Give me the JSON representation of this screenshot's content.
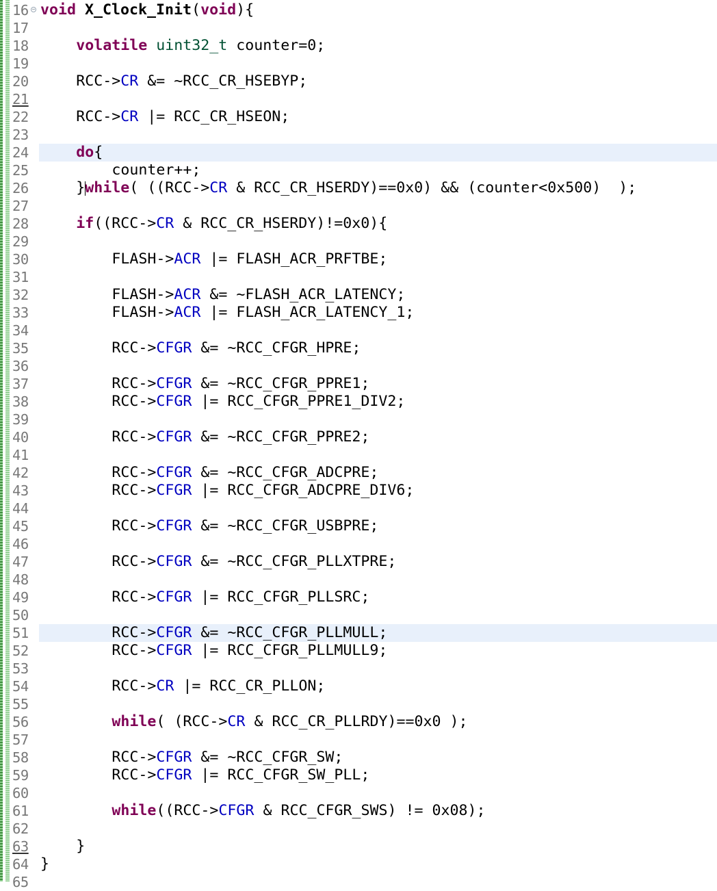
{
  "editor": {
    "language": "c",
    "colors": {
      "keyword": "#7f0055",
      "field": "#0000c0",
      "type": "#005032",
      "line_number": "#787878",
      "current_line_highlight": "#e8f0fb",
      "change_marker": "#3f8f3f"
    },
    "lines": [
      {
        "n": "16",
        "fold": true,
        "indent": 0,
        "tokens": [
          {
            "t": "void",
            "c": "kw"
          },
          {
            "t": " "
          },
          {
            "t": "X_Clock_Init",
            "c": "bold"
          },
          {
            "t": "("
          },
          {
            "t": "void",
            "c": "kw"
          },
          {
            "t": "){"
          }
        ]
      },
      {
        "n": "17",
        "indent": 0,
        "tokens": []
      },
      {
        "n": "18",
        "indent": 1,
        "tokens": [
          {
            "t": "volatile",
            "c": "kw"
          },
          {
            "t": " "
          },
          {
            "t": "uint32_t",
            "c": "type"
          },
          {
            "t": " counter=0;"
          }
        ]
      },
      {
        "n": "19",
        "indent": 0,
        "tokens": []
      },
      {
        "n": "20",
        "indent": 1,
        "tokens": [
          {
            "t": "RCC->"
          },
          {
            "t": "CR",
            "c": "field"
          },
          {
            "t": " &= ~RCC_CR_HSEBYP;"
          }
        ]
      },
      {
        "n": "21",
        "underline": true,
        "indent": 0,
        "tokens": []
      },
      {
        "n": "22",
        "indent": 1,
        "tokens": [
          {
            "t": "RCC->"
          },
          {
            "t": "CR",
            "c": "field"
          },
          {
            "t": " |= RCC_CR_HSEON;"
          }
        ]
      },
      {
        "n": "23",
        "indent": 0,
        "tokens": []
      },
      {
        "n": "24",
        "highlight": true,
        "indent": 1,
        "tokens": [
          {
            "t": "do",
            "c": "kw"
          },
          {
            "t": "{"
          }
        ]
      },
      {
        "n": "25",
        "indent": 2,
        "tokens": [
          {
            "t": "counter++;"
          }
        ]
      },
      {
        "n": "26",
        "indent": 1,
        "cursor": true,
        "tokens": [
          {
            "t": "}"
          },
          {
            "t": "while",
            "c": "kw"
          },
          {
            "t": "( ((RCC->"
          },
          {
            "t": "CR",
            "c": "field"
          },
          {
            "t": " & RCC_CR_HSERDY)==0x0) && (counter<0x500)  );"
          }
        ]
      },
      {
        "n": "27",
        "indent": 0,
        "tokens": []
      },
      {
        "n": "28",
        "indent": 1,
        "tokens": [
          {
            "t": "if",
            "c": "kw"
          },
          {
            "t": "((RCC->"
          },
          {
            "t": "CR",
            "c": "field"
          },
          {
            "t": " & RCC_CR_HSERDY)!=0x0){"
          }
        ]
      },
      {
        "n": "29",
        "indent": 0,
        "tokens": []
      },
      {
        "n": "30",
        "indent": 2,
        "tokens": [
          {
            "t": "FLASH->"
          },
          {
            "t": "ACR",
            "c": "field"
          },
          {
            "t": " |= FLASH_ACR_PRFTBE;"
          }
        ]
      },
      {
        "n": "31",
        "indent": 0,
        "tokens": []
      },
      {
        "n": "32",
        "indent": 2,
        "tokens": [
          {
            "t": "FLASH->"
          },
          {
            "t": "ACR",
            "c": "field"
          },
          {
            "t": " &= ~FLASH_ACR_LATENCY;"
          }
        ]
      },
      {
        "n": "33",
        "indent": 2,
        "tokens": [
          {
            "t": "FLASH->"
          },
          {
            "t": "ACR",
            "c": "field"
          },
          {
            "t": " |= FLASH_ACR_LATENCY_1;"
          }
        ]
      },
      {
        "n": "34",
        "indent": 0,
        "tokens": []
      },
      {
        "n": "35",
        "indent": 2,
        "tokens": [
          {
            "t": "RCC->"
          },
          {
            "t": "CFGR",
            "c": "field"
          },
          {
            "t": " &= ~RCC_CFGR_HPRE;"
          }
        ]
      },
      {
        "n": "36",
        "indent": 0,
        "tokens": []
      },
      {
        "n": "37",
        "indent": 2,
        "tokens": [
          {
            "t": "RCC->"
          },
          {
            "t": "CFGR",
            "c": "field"
          },
          {
            "t": " &= ~RCC_CFGR_PPRE1;"
          }
        ]
      },
      {
        "n": "38",
        "indent": 2,
        "tokens": [
          {
            "t": "RCC->"
          },
          {
            "t": "CFGR",
            "c": "field"
          },
          {
            "t": " |= RCC_CFGR_PPRE1_DIV2;"
          }
        ]
      },
      {
        "n": "39",
        "indent": 0,
        "tokens": []
      },
      {
        "n": "40",
        "indent": 2,
        "tokens": [
          {
            "t": "RCC->"
          },
          {
            "t": "CFGR",
            "c": "field"
          },
          {
            "t": " &= ~RCC_CFGR_PPRE2;"
          }
        ]
      },
      {
        "n": "41",
        "indent": 0,
        "tokens": []
      },
      {
        "n": "42",
        "indent": 2,
        "tokens": [
          {
            "t": "RCC->"
          },
          {
            "t": "CFGR",
            "c": "field"
          },
          {
            "t": " &= ~RCC_CFGR_ADCPRE;"
          }
        ]
      },
      {
        "n": "43",
        "indent": 2,
        "tokens": [
          {
            "t": "RCC->"
          },
          {
            "t": "CFGR",
            "c": "field"
          },
          {
            "t": " |= RCC_CFGR_ADCPRE_DIV6;"
          }
        ]
      },
      {
        "n": "44",
        "indent": 0,
        "tokens": []
      },
      {
        "n": "45",
        "indent": 2,
        "tokens": [
          {
            "t": "RCC->"
          },
          {
            "t": "CFGR",
            "c": "field"
          },
          {
            "t": " &= ~RCC_CFGR_USBPRE;"
          }
        ]
      },
      {
        "n": "46",
        "indent": 0,
        "tokens": []
      },
      {
        "n": "47",
        "indent": 2,
        "tokens": [
          {
            "t": "RCC->"
          },
          {
            "t": "CFGR",
            "c": "field"
          },
          {
            "t": " &= ~RCC_CFGR_PLLXTPRE;"
          }
        ]
      },
      {
        "n": "48",
        "indent": 0,
        "tokens": []
      },
      {
        "n": "49",
        "indent": 2,
        "tokens": [
          {
            "t": "RCC->"
          },
          {
            "t": "CFGR",
            "c": "field"
          },
          {
            "t": " |= RCC_CFGR_PLLSRC;"
          }
        ]
      },
      {
        "n": "50",
        "indent": 0,
        "tokens": []
      },
      {
        "n": "51",
        "highlight": true,
        "indent": 2,
        "tokens": [
          {
            "t": "RCC->"
          },
          {
            "t": "CFGR",
            "c": "field"
          },
          {
            "t": " &= ~RCC_CFGR_PLLMULL;"
          }
        ]
      },
      {
        "n": "52",
        "indent": 2,
        "tokens": [
          {
            "t": "RCC->"
          },
          {
            "t": "CFGR",
            "c": "field"
          },
          {
            "t": " |= RCC_CFGR_PLLMULL9;"
          }
        ]
      },
      {
        "n": "53",
        "indent": 0,
        "tokens": []
      },
      {
        "n": "54",
        "indent": 2,
        "tokens": [
          {
            "t": "RCC->"
          },
          {
            "t": "CR",
            "c": "field"
          },
          {
            "t": " |= RCC_CR_PLLON;"
          }
        ]
      },
      {
        "n": "55",
        "indent": 0,
        "tokens": []
      },
      {
        "n": "56",
        "indent": 2,
        "tokens": [
          {
            "t": "while",
            "c": "kw"
          },
          {
            "t": "( (RCC->"
          },
          {
            "t": "CR",
            "c": "field"
          },
          {
            "t": " & RCC_CR_PLLRDY)==0x0 );"
          }
        ]
      },
      {
        "n": "57",
        "indent": 0,
        "tokens": []
      },
      {
        "n": "58",
        "indent": 2,
        "tokens": [
          {
            "t": "RCC->"
          },
          {
            "t": "CFGR",
            "c": "field"
          },
          {
            "t": " &= ~RCC_CFGR_SW;"
          }
        ]
      },
      {
        "n": "59",
        "indent": 2,
        "tokens": [
          {
            "t": "RCC->"
          },
          {
            "t": "CFGR",
            "c": "field"
          },
          {
            "t": " |= RCC_CFGR_SW_PLL;"
          }
        ]
      },
      {
        "n": "60",
        "indent": 0,
        "tokens": []
      },
      {
        "n": "61",
        "indent": 2,
        "tokens": [
          {
            "t": "while",
            "c": "kw"
          },
          {
            "t": "((RCC->"
          },
          {
            "t": "CFGR",
            "c": "field"
          },
          {
            "t": " & RCC_CFGR_SWS) != 0x08);"
          }
        ]
      },
      {
        "n": "62",
        "indent": 0,
        "tokens": []
      },
      {
        "n": "63",
        "underline": true,
        "indent": 1,
        "tokens": [
          {
            "t": "}"
          }
        ]
      },
      {
        "n": "64",
        "indent": 0,
        "tokens": [
          {
            "t": "}"
          }
        ]
      },
      {
        "n": "65",
        "indent": 0,
        "tokens": []
      }
    ]
  }
}
